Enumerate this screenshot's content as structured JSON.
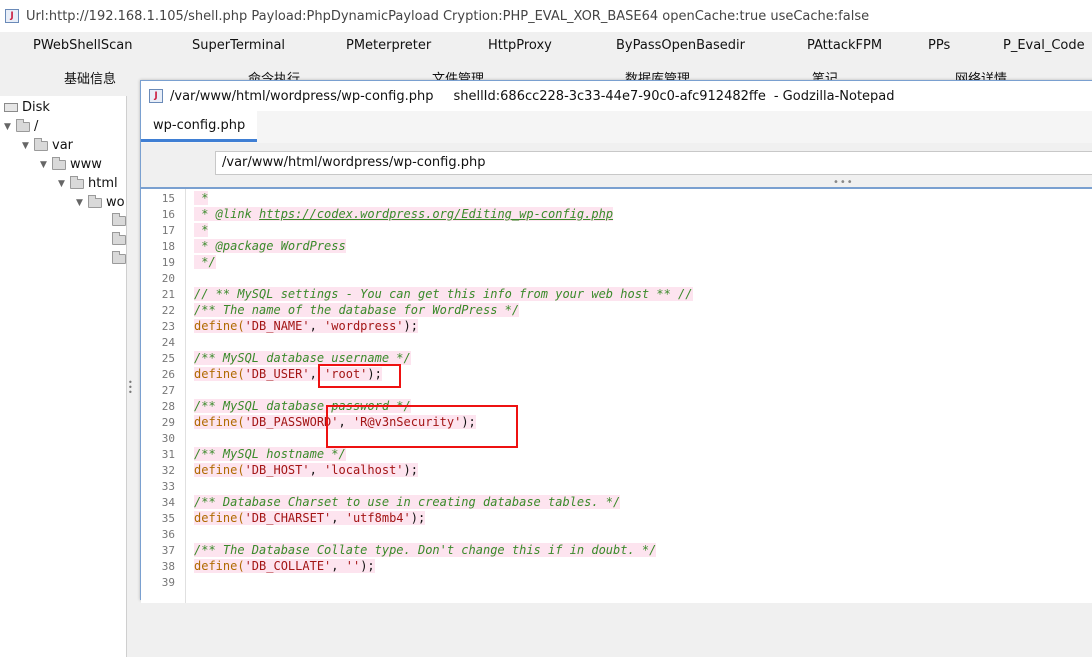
{
  "window": {
    "title": "Url:http://192.168.1.105/shell.php Payload:PhpDynamicPayload Cryption:PHP_EVAL_XOR_BASE64 openCache:true useCache:false"
  },
  "plugins_row1": [
    "PWebShellScan",
    "SuperTerminal",
    "PMeterpreter",
    "HttpProxy",
    "ByPassOpenBasedir",
    "PAttackFPM",
    "PPs",
    "P_Eval_Code"
  ],
  "plugins_row2": [
    "基础信息",
    "命令执行",
    "文件管理",
    "数据库管理",
    "笔记",
    "网络详情"
  ],
  "tree": {
    "root": "Disk",
    "nodes": [
      "/",
      "var",
      "www",
      "html",
      "wo"
    ]
  },
  "notepad": {
    "title_path": "/var/www/html/wordpress/wp-config.php",
    "shell_id": "shellId:686cc228-3c33-44e7-90c0-afc912482ffe",
    "app_name": "- Godzilla-Notepad",
    "tab_label": "wp-config.php",
    "path_value": "/var/www/html/wordpress/wp-config.php"
  },
  "code_lines": [
    {
      "n": "15",
      "hl": true,
      "parts": [
        {
          "t": " *",
          "c": "c"
        }
      ]
    },
    {
      "n": "16",
      "hl": true,
      "parts": [
        {
          "t": " * @link ",
          "c": "c"
        },
        {
          "t": "https://codex.wordpress.org/Editing_wp-config.php",
          "c": "c u"
        }
      ]
    },
    {
      "n": "17",
      "hl": true,
      "parts": [
        {
          "t": " *",
          "c": "c"
        }
      ]
    },
    {
      "n": "18",
      "hl": true,
      "parts": [
        {
          "t": " * @package WordPress",
          "c": "c"
        }
      ]
    },
    {
      "n": "19",
      "hl": true,
      "parts": [
        {
          "t": " */",
          "c": "c"
        }
      ]
    },
    {
      "n": "20",
      "hl": false,
      "parts": []
    },
    {
      "n": "21",
      "hl": true,
      "parts": [
        {
          "t": "// ** MySQL settings - You can get this info from your web host ** //",
          "c": "c"
        }
      ]
    },
    {
      "n": "22",
      "hl": true,
      "parts": [
        {
          "t": "/** The name of the database for WordPress */",
          "c": "c"
        }
      ]
    },
    {
      "n": "23",
      "hl": true,
      "parts": [
        {
          "t": "define(",
          "c": "k"
        },
        {
          "t": "'DB_NAME'",
          "c": "s"
        },
        {
          "t": ", ",
          "c": ""
        },
        {
          "t": "'wordpress'",
          "c": "s"
        },
        {
          "t": ");",
          "c": ""
        }
      ]
    },
    {
      "n": "24",
      "hl": false,
      "parts": []
    },
    {
      "n": "25",
      "hl": true,
      "parts": [
        {
          "t": "/** MySQL database username */",
          "c": "c"
        }
      ]
    },
    {
      "n": "26",
      "hl": true,
      "parts": [
        {
          "t": "define(",
          "c": "k"
        },
        {
          "t": "'DB_USER'",
          "c": "s"
        },
        {
          "t": ", ",
          "c": ""
        },
        {
          "t": "'root'",
          "c": "s"
        },
        {
          "t": ");",
          "c": ""
        }
      ]
    },
    {
      "n": "27",
      "hl": false,
      "parts": []
    },
    {
      "n": "28",
      "hl": true,
      "parts": [
        {
          "t": "/** MySQL database password */",
          "c": "c"
        }
      ]
    },
    {
      "n": "29",
      "hl": true,
      "parts": [
        {
          "t": "define(",
          "c": "k"
        },
        {
          "t": "'DB_PASSWORD'",
          "c": "s"
        },
        {
          "t": ", ",
          "c": ""
        },
        {
          "t": "'R@v3nSecurity'",
          "c": "s"
        },
        {
          "t": ");",
          "c": ""
        }
      ]
    },
    {
      "n": "30",
      "hl": false,
      "parts": []
    },
    {
      "n": "31",
      "hl": true,
      "parts": [
        {
          "t": "/** MySQL hostname */",
          "c": "c"
        }
      ]
    },
    {
      "n": "32",
      "hl": true,
      "parts": [
        {
          "t": "define(",
          "c": "k"
        },
        {
          "t": "'DB_HOST'",
          "c": "s"
        },
        {
          "t": ", ",
          "c": ""
        },
        {
          "t": "'localhost'",
          "c": "s"
        },
        {
          "t": ");",
          "c": ""
        }
      ]
    },
    {
      "n": "33",
      "hl": false,
      "parts": []
    },
    {
      "n": "34",
      "hl": true,
      "parts": [
        {
          "t": "/** Database Charset to use in creating database tables. */",
          "c": "c"
        }
      ]
    },
    {
      "n": "35",
      "hl": true,
      "parts": [
        {
          "t": "define(",
          "c": "k"
        },
        {
          "t": "'DB_CHARSET'",
          "c": "s"
        },
        {
          "t": ", ",
          "c": ""
        },
        {
          "t": "'utf8mb4'",
          "c": "s"
        },
        {
          "t": ");",
          "c": ""
        }
      ]
    },
    {
      "n": "36",
      "hl": false,
      "parts": []
    },
    {
      "n": "37",
      "hl": true,
      "parts": [
        {
          "t": "/** The Database Collate type. Don't change this if in doubt. */",
          "c": "c"
        }
      ]
    },
    {
      "n": "38",
      "hl": true,
      "parts": [
        {
          "t": "define(",
          "c": "k"
        },
        {
          "t": "'DB_COLLATE'",
          "c": "s"
        },
        {
          "t": ", ",
          "c": ""
        },
        {
          "t": "''",
          "c": "s"
        },
        {
          "t": ");",
          "c": ""
        }
      ]
    },
    {
      "n": "39",
      "hl": false,
      "parts": []
    }
  ],
  "colors": {
    "comment": "#3a8a2a",
    "keyword": "#b06a00",
    "string": "#a31515",
    "line_highlight": "#fde4ef",
    "annotation_box": "#ee1111",
    "accent": "#3f7fd4"
  }
}
